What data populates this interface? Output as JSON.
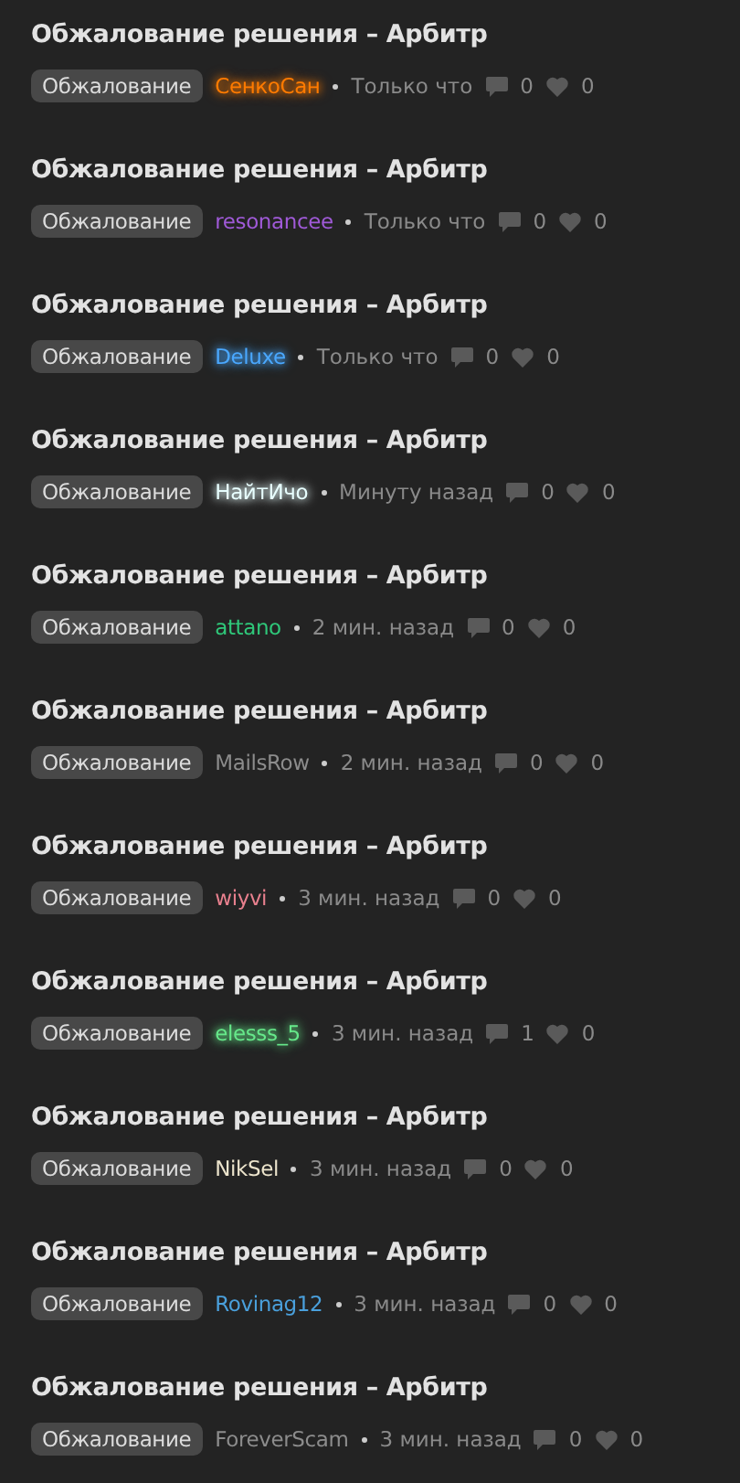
{
  "threads": [
    {
      "title": "Обжалование решения – Арбитр",
      "tag": "Обжалование",
      "author": "СенкоСан",
      "color": "#ff7b00",
      "glow": true,
      "time": "Только что",
      "replies": "0",
      "likes": "0"
    },
    {
      "title": "Обжалование решения – Арбитр",
      "tag": "Обжалование",
      "author": "resonancee",
      "color": "#a05ad8",
      "glow": false,
      "time": "Только что",
      "replies": "0",
      "likes": "0"
    },
    {
      "title": "Обжалование решения – Арбитр",
      "tag": "Обжалование",
      "author": "Deluxe",
      "color": "#4aa8ff",
      "glow": true,
      "time": "Только что",
      "replies": "0",
      "likes": "0"
    },
    {
      "title": "Обжалование решения – Арбитр",
      "tag": "Обжалование",
      "author": "НайтИчо",
      "color": "#e8ffff",
      "glow": true,
      "time": "Минуту назад",
      "replies": "0",
      "likes": "0"
    },
    {
      "title": "Обжалование решения – Арбитр",
      "tag": "Обжалование",
      "author": "attano",
      "color": "#2fc87a",
      "glow": false,
      "time": "2 мин. назад",
      "replies": "0",
      "likes": "0"
    },
    {
      "title": "Обжалование решения – Арбитр",
      "tag": "Обжалование",
      "author": "MailsRow",
      "color": "#8c8c8c",
      "glow": false,
      "time": "2 мин. назад",
      "replies": "0",
      "likes": "0"
    },
    {
      "title": "Обжалование решения – Арбитр",
      "tag": "Обжалование",
      "author": "wiyvi",
      "color": "#e8808e",
      "glow": false,
      "time": "3 мин. назад",
      "replies": "0",
      "likes": "0"
    },
    {
      "title": "Обжалование решения – Арбитр",
      "tag": "Обжалование",
      "author": "elesss_5",
      "color": "#66e88a",
      "glow": true,
      "time": "3 мин. назад",
      "replies": "1",
      "likes": "0"
    },
    {
      "title": "Обжалование решения – Арбитр",
      "tag": "Обжалование",
      "author": "NikSel",
      "color": "#ece4cc",
      "glow": false,
      "time": "3 мин. назад",
      "replies": "0",
      "likes": "0"
    },
    {
      "title": "Обжалование решения – Арбитр",
      "tag": "Обжалование",
      "author": "Rovinag12",
      "color": "#4aa0dc",
      "glow": false,
      "time": "3 мин. назад",
      "replies": "0",
      "likes": "0"
    },
    {
      "title": "Обжалование решения – Арбитр",
      "tag": "Обжалование",
      "author": "ForeverScam",
      "color": "#8c8c8c",
      "glow": false,
      "time": "3 мин. назад",
      "replies": "0",
      "likes": "0"
    }
  ]
}
